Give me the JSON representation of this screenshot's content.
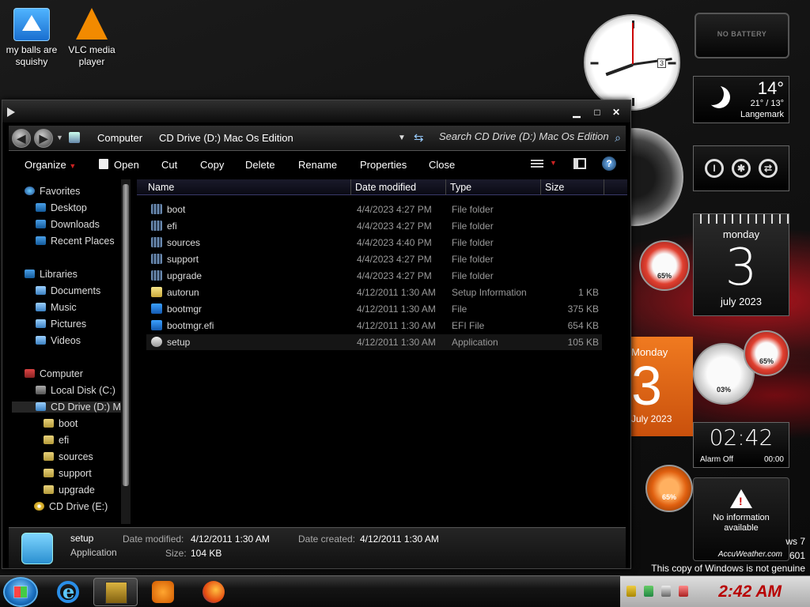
{
  "desktop": {
    "icons": [
      {
        "label_line1": "my balls are",
        "label_line2": "squishy",
        "icon": "folder-icon"
      },
      {
        "label_line1": "VLC media",
        "label_line2": "player",
        "icon": "vlc-icon"
      }
    ]
  },
  "gadgets": {
    "battery": "NO BATTERY",
    "weather": {
      "temp": "14°",
      "range": "21° / 13°",
      "place": "Langemark"
    },
    "calendar": {
      "day": "monday",
      "num": "3",
      "month": "july 2023"
    },
    "calendar_orange": {
      "day": "Monday",
      "num": "3",
      "month": "July 2023"
    },
    "alarm": {
      "time": "02:42",
      "status": "Alarm Off",
      "countdown": "00:00"
    },
    "gauges": {
      "g1": "65%",
      "g2": "03%",
      "g3": "65%",
      "g4": "65%"
    },
    "clock_date": "3",
    "accuweather": {
      "line1": "No information",
      "line2": "available",
      "brand": "AccuWeather.com"
    },
    "watermark": {
      "line1": "ws 7",
      "line2": "601",
      "line3": "This copy of Windows is not genuine"
    }
  },
  "window": {
    "controls": {
      "minimize": "▁",
      "maximize": "□",
      "close": "✕"
    },
    "address": {
      "crumb1": "Computer",
      "crumb2": "CD Drive (D:) Mac Os Edition"
    },
    "search_placeholder": "Search CD Drive (D:) Mac Os Edition",
    "toolbar": {
      "organize": "Organize",
      "open": "Open",
      "cut": "Cut",
      "copy": "Copy",
      "delete": "Delete",
      "rename": "Rename",
      "properties": "Properties",
      "close": "Close"
    },
    "nav": {
      "favorites": "Favorites",
      "desktop": "Desktop",
      "downloads": "Downloads",
      "recent": "Recent Places",
      "libraries": "Libraries",
      "documents": "Documents",
      "music": "Music",
      "pictures": "Pictures",
      "videos": "Videos",
      "computer": "Computer",
      "local_disk": "Local Disk (C:)",
      "cd_drive_d": "CD Drive (D:) Ma",
      "boot": "boot",
      "efi": "efi",
      "sources": "sources",
      "support": "support",
      "upgrade": "upgrade",
      "cd_drive_e": "CD Drive (E:)"
    },
    "columns": {
      "name": "Name",
      "date": "Date modified",
      "type": "Type",
      "size": "Size"
    },
    "files": [
      {
        "name": "boot",
        "date": "4/4/2023 4:27 PM",
        "type": "File folder",
        "size": "",
        "kind": "folder"
      },
      {
        "name": "efi",
        "date": "4/4/2023 4:27 PM",
        "type": "File folder",
        "size": "",
        "kind": "folder"
      },
      {
        "name": "sources",
        "date": "4/4/2023 4:40 PM",
        "type": "File folder",
        "size": "",
        "kind": "folder"
      },
      {
        "name": "support",
        "date": "4/4/2023 4:27 PM",
        "type": "File folder",
        "size": "",
        "kind": "folder"
      },
      {
        "name": "upgrade",
        "date": "4/4/2023 4:27 PM",
        "type": "File folder",
        "size": "",
        "kind": "folder"
      },
      {
        "name": "autorun",
        "date": "4/12/2011 1:30 AM",
        "type": "Setup Information",
        "size": "1 KB",
        "kind": "inf"
      },
      {
        "name": "bootmgr",
        "date": "4/12/2011 1:30 AM",
        "type": "File",
        "size": "375 KB",
        "kind": "file"
      },
      {
        "name": "bootmgr.efi",
        "date": "4/12/2011 1:30 AM",
        "type": "EFI File",
        "size": "654 KB",
        "kind": "file"
      },
      {
        "name": "setup",
        "date": "4/12/2011 1:30 AM",
        "type": "Application",
        "size": "105 KB",
        "kind": "app"
      }
    ],
    "details": {
      "name": "setup",
      "type": "Application",
      "modified_label": "Date modified:",
      "modified": "4/12/2011 1:30 AM",
      "created_label": "Date created:",
      "created": "4/12/2011 1:30 AM",
      "size_label": "Size:",
      "size": "104 KB"
    }
  },
  "taskbar": {
    "clock": "2:42 AM"
  }
}
